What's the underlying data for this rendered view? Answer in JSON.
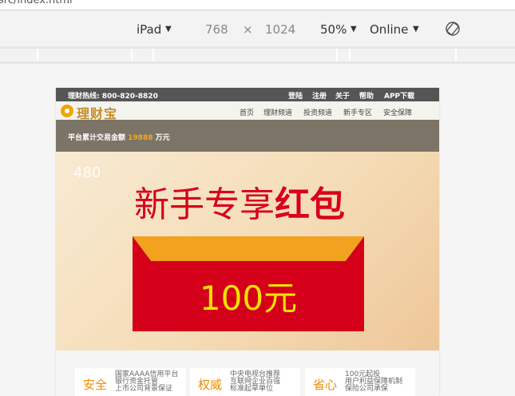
{
  "browser": {
    "url_fragment": "src/index.html"
  },
  "device_toolbar": {
    "device": "iPad",
    "width": "768",
    "times": "×",
    "height": "1024",
    "zoom": "50%",
    "network": "Online",
    "caret": "▼"
  },
  "page": {
    "hotline": "理财热线: 800-820-8820",
    "top_links": [
      "登陆",
      "注册",
      "关于",
      "帮助",
      "APP下载"
    ],
    "logo": "理财宝",
    "nav": [
      "首页",
      "理财频道",
      "投资频道",
      "新手专区",
      "安全保障"
    ],
    "totals": {
      "label": "平台累计交易金额",
      "value": "19888",
      "unit": "万元"
    },
    "banner": {
      "width_label": "480",
      "promo_plain": "新手专享",
      "promo_bold": "红包",
      "amount": "100元"
    },
    "features": [
      {
        "key": "安全",
        "desc": [
          "国家AAAA信用平台",
          "银行资金托管",
          "上市公司背景保证"
        ]
      },
      {
        "key": "权威",
        "desc": [
          "中央电视台推荐",
          "互联网企业百强",
          "标准起草单位"
        ]
      },
      {
        "key": "省心",
        "desc": [
          "100元起投",
          "用户利益保障机制",
          "保险公司承保"
        ]
      }
    ]
  },
  "colors": {
    "accent": "#f5a623",
    "red": "#d40019",
    "header_bg": "#7c7466"
  }
}
